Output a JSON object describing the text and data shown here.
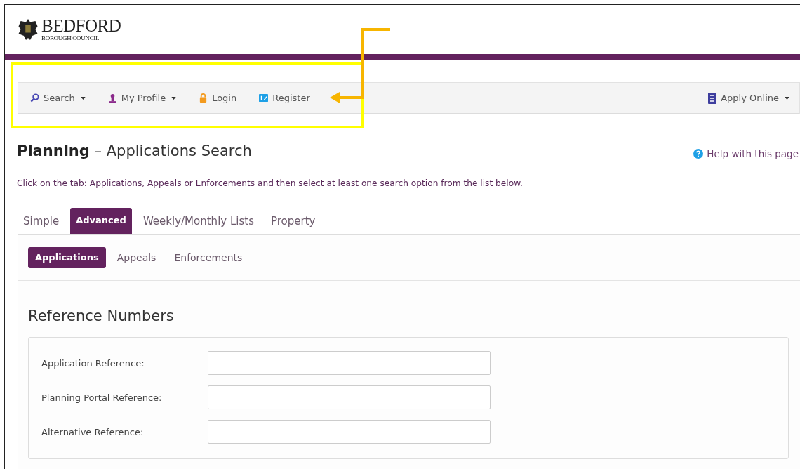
{
  "logo": {
    "name": "BEDFORD",
    "subtitle": "BOROUGH COUNCIL"
  },
  "navbar": {
    "items": [
      {
        "label": "Search",
        "kind": "search",
        "has_menu": true
      },
      {
        "label": "My Profile",
        "kind": "profile",
        "has_menu": true
      },
      {
        "label": "Login",
        "kind": "login",
        "has_menu": false
      },
      {
        "label": "Register",
        "kind": "register",
        "has_menu": false
      }
    ],
    "right_items": [
      {
        "label": "Apply Online",
        "kind": "apply",
        "has_menu": true
      }
    ]
  },
  "page": {
    "title": "**Planning** – Applications Search",
    "help_link": "Help with this page",
    "instruction": "Click on the tab: Applications, Appeals or Enforcements and then select at least one search option from the list below."
  },
  "tabs": [
    {
      "label": "Simple",
      "selected": false
    },
    {
      "label": "Advanced",
      "selected": true
    },
    {
      "label": "Weekly/Monthly Lists",
      "selected": false
    },
    {
      "label": "Property",
      "selected": false
    }
  ],
  "sub_tabs": [
    {
      "label": "Applications",
      "selected": true
    },
    {
      "label": "Appeals",
      "selected": false
    },
    {
      "label": "Enforcements",
      "selected": false
    }
  ],
  "section": {
    "title": "Reference Numbers",
    "fields": [
      {
        "label": "Application Reference:"
      },
      {
        "label": "Planning Portal Reference:"
      },
      {
        "label": "Alternative Reference:"
      }
    ]
  }
}
